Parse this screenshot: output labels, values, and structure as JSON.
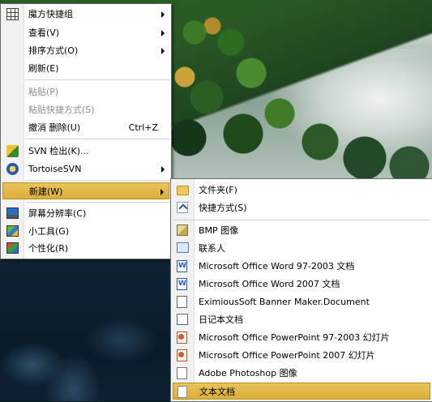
{
  "main_menu": {
    "items": [
      {
        "label": "魔方快捷组",
        "icon": "grid-icon",
        "has_submenu": true
      },
      {
        "label": "查看(V)",
        "has_submenu": true
      },
      {
        "label": "排序方式(O)",
        "has_submenu": true
      },
      {
        "label": "刷新(E)"
      },
      {
        "label": "粘贴(P)",
        "disabled": true
      },
      {
        "label": "粘贴快捷方式(S)",
        "disabled": true
      },
      {
        "label": "撤消 删除(U)",
        "shortcut": "Ctrl+Z"
      },
      {
        "label": "SVN 检出(K)...",
        "icon": "svn-checkout-icon"
      },
      {
        "label": "TortoiseSVN",
        "icon": "tortoisesvn-icon",
        "has_submenu": true
      },
      {
        "label": "新建(W)",
        "has_submenu": true,
        "highlighted": true
      },
      {
        "label": "屏幕分辨率(C)",
        "icon": "screen-resolution-icon"
      },
      {
        "label": "小工具(G)",
        "icon": "gadgets-icon"
      },
      {
        "label": "个性化(R)",
        "icon": "personalize-icon"
      }
    ]
  },
  "new_submenu": {
    "items": [
      {
        "label": "文件夹(F)",
        "icon": "folder-icon"
      },
      {
        "label": "快捷方式(S)",
        "icon": "shortcut-icon"
      },
      {
        "label": "BMP 图像",
        "icon": "bmp-image-icon"
      },
      {
        "label": "联系人",
        "icon": "contact-icon"
      },
      {
        "label": "Microsoft Office Word 97-2003 文档",
        "icon": "word-97-2003-icon"
      },
      {
        "label": "Microsoft Office Word 2007 文档",
        "icon": "word-2007-icon"
      },
      {
        "label": "EximiousSoft Banner Maker.Document",
        "icon": "banner-maker-document-icon"
      },
      {
        "label": "日记本文档",
        "icon": "journal-document-icon"
      },
      {
        "label": "Microsoft Office PowerPoint 97-2003 幻灯片",
        "icon": "powerpoint-97-2003-icon"
      },
      {
        "label": "Microsoft Office PowerPoint 2007 幻灯片",
        "icon": "powerpoint-2007-icon"
      },
      {
        "label": "Adobe Photoshop 图像",
        "icon": "photoshop-image-icon"
      },
      {
        "label": "文本文档",
        "icon": "text-document-icon",
        "highlighted": true
      }
    ]
  }
}
